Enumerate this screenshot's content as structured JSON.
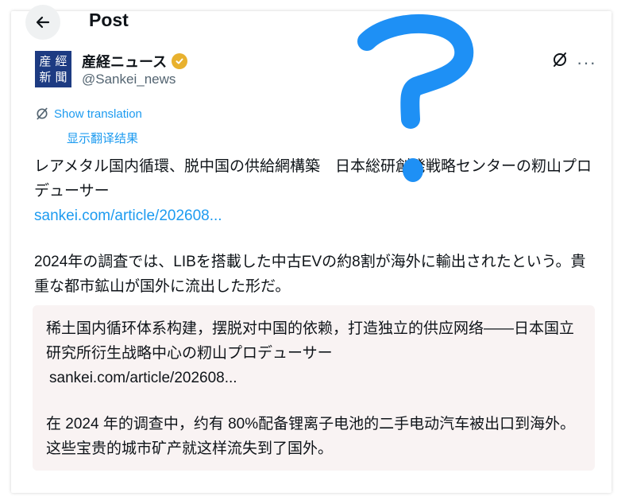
{
  "header": {
    "title": "Post"
  },
  "author": {
    "name": "産経ニュース",
    "handle": "@Sankei_news",
    "avatar_chars": [
      "産",
      "經",
      "新",
      "聞"
    ]
  },
  "translation": {
    "show_label": "Show translation",
    "translated_label": "显示翻译结果"
  },
  "tweet": {
    "headline": "レアメタル国内循環、脱中国の供給網構築　日本総研創発戦略センターの籾山プロデューサー",
    "link": "sankei.com/article/202608...",
    "body": "2024年の調査では、LIBを搭載した中古EVの約8割が海外に輸出されたという。貴重な都市鉱山が国外に流出した形だ。"
  },
  "quote": {
    "headline": "稀土国内循环体系构建，摆脱对中国的依赖，打造独立的供应网络——日本国立研究所衍生战略中心の籾山プロデューサー",
    "link": "sankei.com/article/202608...",
    "body": "在 2024 年的调查中，约有 80%配备锂离子电池的二手电动汽车被出口到海外。这些宝贵的城市矿产就这样流失到了国外。"
  },
  "colors": {
    "accent": "#1d9bf0",
    "annotation": "#1e90f5",
    "verified": "#e8b12e",
    "avatar_bg": "#1d3b82"
  },
  "icons": [
    "back-arrow-icon",
    "verified-badge-icon",
    "grok-icon",
    "more-icon",
    "translate-icon"
  ]
}
